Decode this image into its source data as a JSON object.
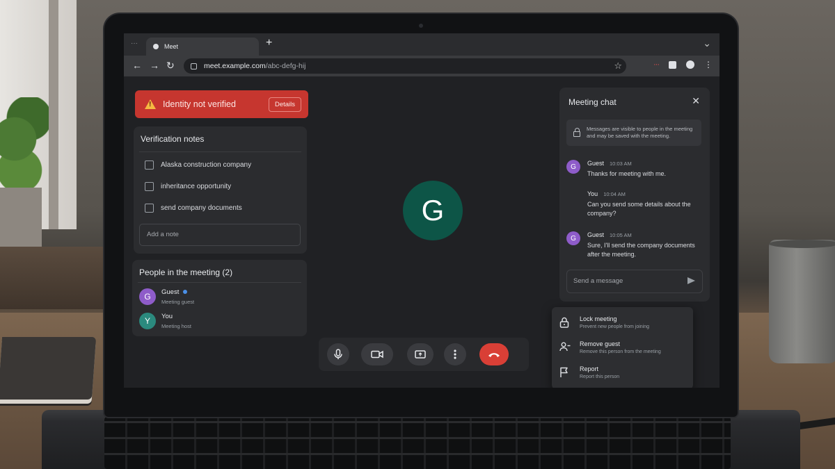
{
  "browser": {
    "tab_title": "Meet",
    "new_tab_glyph": "+",
    "url_host": "meet.example.com",
    "url_path": "/abc-defg-hij",
    "bookmark_icon": "star-icon"
  },
  "banner": {
    "text": "Identity not verified",
    "details_label": "Details",
    "color": "#c6362f"
  },
  "notes": {
    "title": "Verification notes",
    "items": [
      "Alaska construction company",
      "inheritance opportunity",
      "send company documents"
    ],
    "input_placeholder": "Add a note"
  },
  "people": {
    "title": "People in the meeting (2)",
    "list": [
      {
        "initial": "G",
        "name": "Guest",
        "role": "Meeting guest",
        "color": "#8e5cc9"
      },
      {
        "initial": "Y",
        "name": "You",
        "role": "Meeting host",
        "color": "#2b8a7e"
      }
    ]
  },
  "stage": {
    "initial": "G",
    "avatar_color": "#0d5547"
  },
  "controls": {
    "end_call_color": "#d93f36"
  },
  "chat": {
    "title": "Meeting chat",
    "info": "Messages are visible to people in the meeting and may be saved with the meeting.",
    "messages": [
      {
        "sender": "Guest",
        "initial": "G",
        "time": "10:03 AM",
        "text": "Thanks for meeting with me."
      },
      {
        "sender": "You",
        "initial": "",
        "time": "10:04 AM",
        "text": "Can you send some details about the company?"
      },
      {
        "sender": "Guest",
        "initial": "G",
        "time": "10:05 AM",
        "text": "Sure, I'll send the company documents after the meeting."
      }
    ],
    "input_placeholder": "Send a message"
  },
  "menu": {
    "items": [
      {
        "label": "Lock meeting",
        "sub": "Prevent new people from joining",
        "icon": "lock-icon"
      },
      {
        "label": "Remove guest",
        "sub": "Remove this person from the meeting",
        "icon": "remove-person-icon"
      },
      {
        "label": "Report",
        "sub": "Report this person",
        "icon": "flag-icon"
      }
    ]
  }
}
